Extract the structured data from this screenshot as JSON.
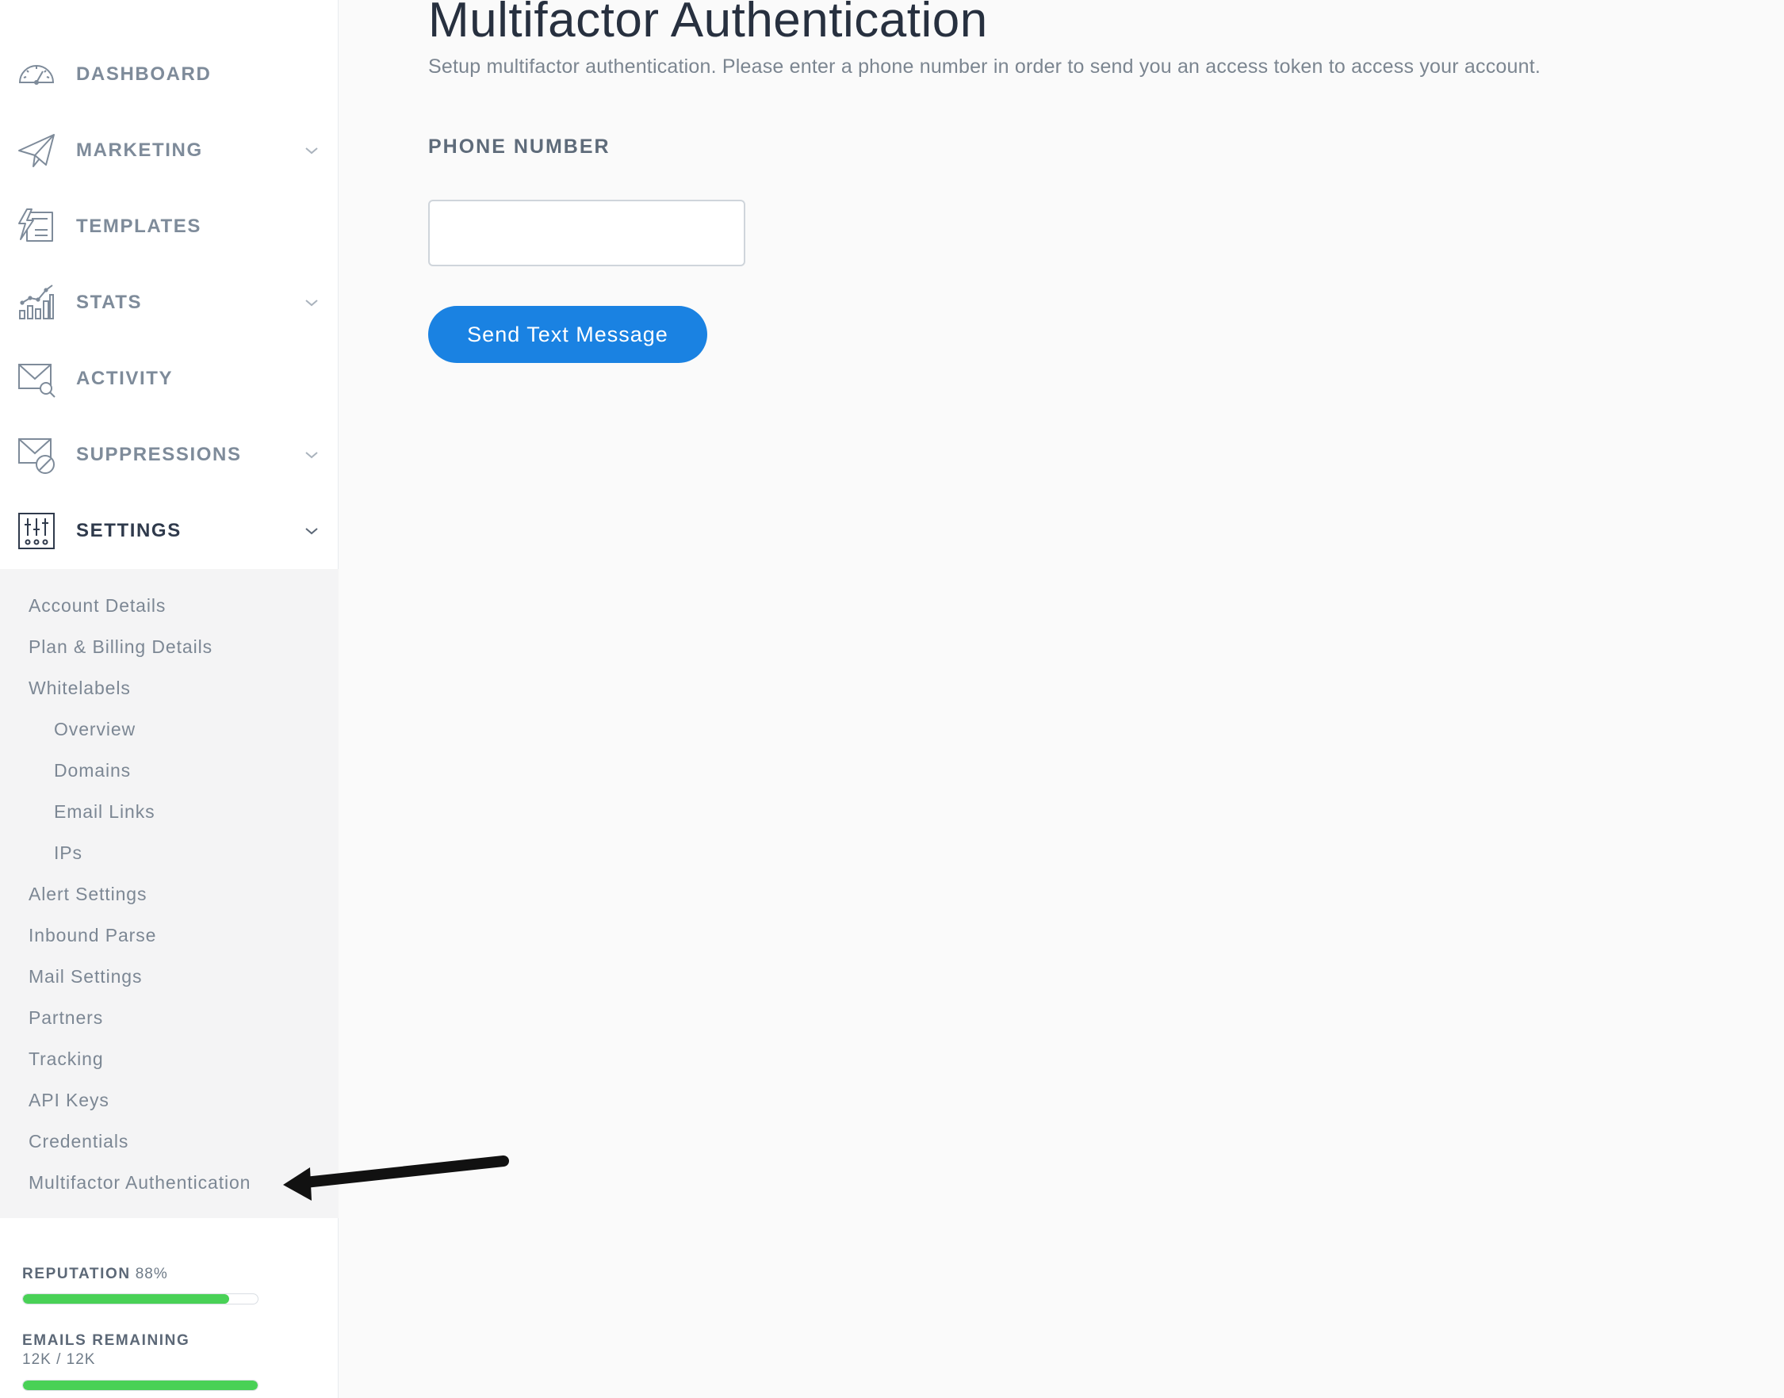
{
  "sidebar": {
    "nav": [
      {
        "label": "DASHBOARD",
        "icon": "dashboard-gauge-icon"
      },
      {
        "label": "MARKETING",
        "icon": "paper-plane-icon",
        "has_children": true
      },
      {
        "label": "TEMPLATES",
        "icon": "templates-icon"
      },
      {
        "label": "STATS",
        "icon": "stats-chart-icon",
        "has_children": true
      },
      {
        "label": "ACTIVITY",
        "icon": "envelope-search-icon"
      },
      {
        "label": "SUPPRESSIONS",
        "icon": "envelope-block-icon",
        "has_children": true
      },
      {
        "label": "SETTINGS",
        "icon": "settings-sliders-icon",
        "has_children": true,
        "active": true
      }
    ],
    "settings_submenu": [
      {
        "label": "Account Details"
      },
      {
        "label": "Plan & Billing Details"
      },
      {
        "label": "Whitelabels"
      },
      {
        "label": "Overview",
        "nested": true
      },
      {
        "label": "Domains",
        "nested": true
      },
      {
        "label": "Email Links",
        "nested": true
      },
      {
        "label": "IPs",
        "nested": true
      },
      {
        "label": "Alert Settings"
      },
      {
        "label": "Inbound Parse"
      },
      {
        "label": "Mail Settings"
      },
      {
        "label": "Partners"
      },
      {
        "label": "Tracking"
      },
      {
        "label": "API Keys"
      },
      {
        "label": "Credentials"
      },
      {
        "label": "Multifactor Authentication",
        "selected": true
      }
    ],
    "reputation": {
      "label": "REPUTATION",
      "value": "88%",
      "percent": 88
    },
    "emails_remaining": {
      "label": "EMAILS REMAINING",
      "value": "12K / 12K",
      "percent": 100
    }
  },
  "main": {
    "title": "Multifactor Authentication",
    "description": "Setup multifactor authentication. Please enter a phone number in order to send you an access token to access your account.",
    "phone_label": "PHONE NUMBER",
    "phone_value": "",
    "send_button": "Send Text Message"
  },
  "colors": {
    "accent": "#1a82e2",
    "meter_green": "#49d156",
    "nav_text": "#7e8b9a",
    "nav_active_text": "#2f3a4c"
  }
}
